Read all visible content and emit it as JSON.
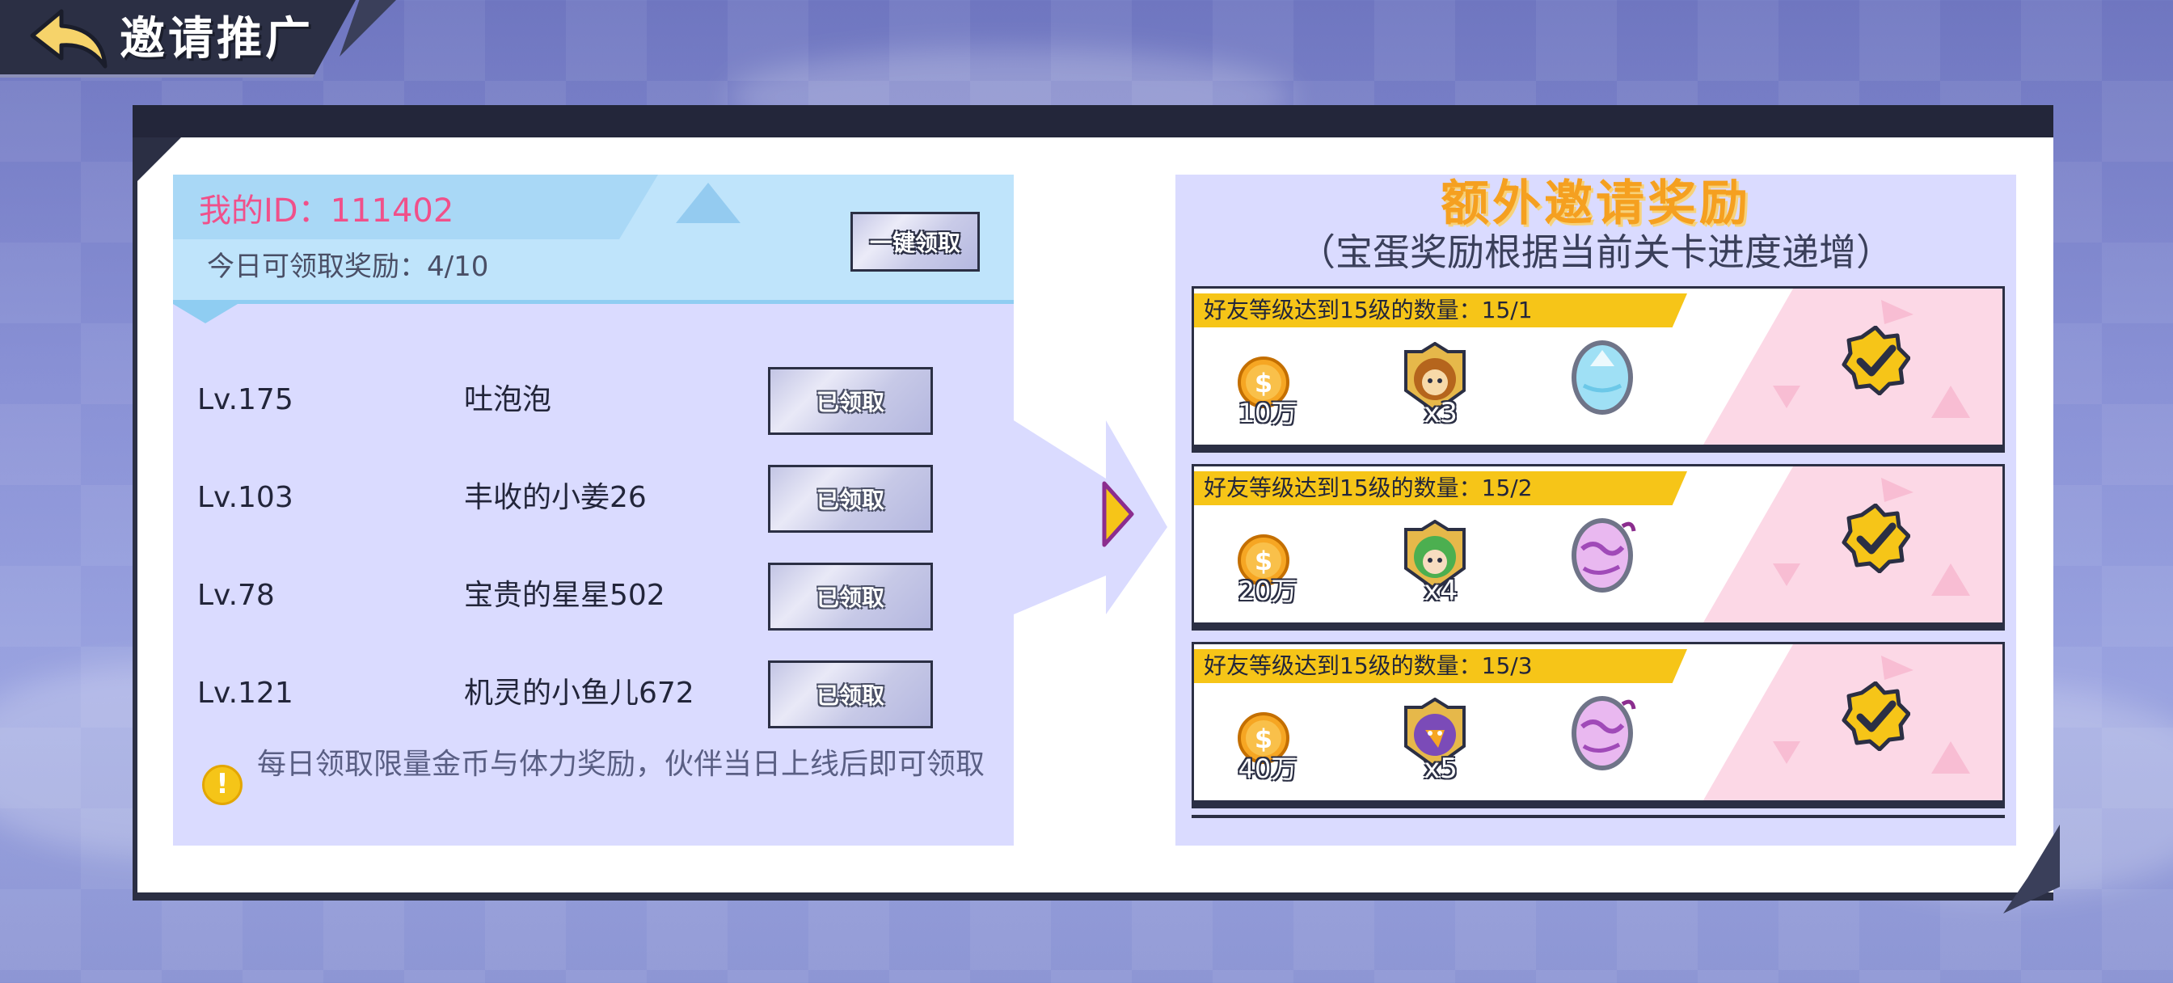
{
  "header": {
    "title": "邀请推广"
  },
  "left": {
    "my_id": "我的ID：111402",
    "today_claim": "今日可领取奖励：4/10",
    "one_key_claim": "一键领取",
    "friends": [
      {
        "level": "Lv.175",
        "name": "吐泡泡",
        "status": "已领取"
      },
      {
        "level": "Lv.103",
        "name": "丰收的小姜26",
        "status": "已领取"
      },
      {
        "level": "Lv.78",
        "name": "宝贵的星星502",
        "status": "已领取"
      },
      {
        "level": "Lv.121",
        "name": "机灵的小鱼儿672",
        "status": "已领取"
      }
    ],
    "notice": "每日领取限量金币与体力奖励，伙伴当日上线后即可领取"
  },
  "right": {
    "title": "额外邀请奖励",
    "subtitle": "（宝蛋奖励根据当前关卡进度递增）",
    "rewards": [
      {
        "condition": "好友等级达到15级的数量：15/1",
        "coins": "10万",
        "hero_count": "x3",
        "egg": "blue-egg",
        "claimed": true
      },
      {
        "condition": "好友等级达到15级的数量：15/2",
        "coins": "20万",
        "hero_count": "x4",
        "egg": "purple-egg",
        "claimed": true
      },
      {
        "condition": "好友等级达到15级的数量：15/3",
        "coins": "40万",
        "hero_count": "x5",
        "egg": "purple-egg",
        "claimed": true
      }
    ]
  },
  "colors": {
    "accent_pink": "#f0508a",
    "title_orange": "#f5a020",
    "banner_yellow": "#f6c518",
    "panel_lavender": "#dadbff"
  }
}
